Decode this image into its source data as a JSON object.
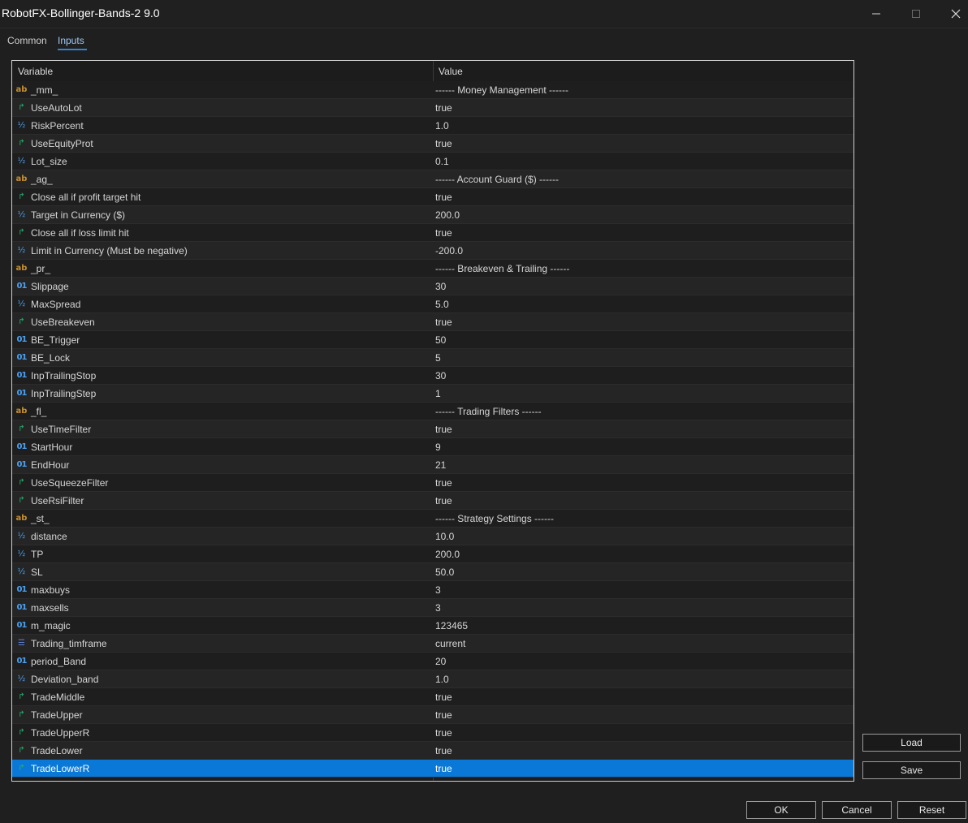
{
  "window": {
    "title": "RobotFX-Bollinger-Bands-2 9.0"
  },
  "tabs": [
    {
      "label": "Common"
    },
    {
      "label": "Inputs"
    }
  ],
  "table": {
    "headers": {
      "variable": "Variable",
      "value": "Value"
    },
    "rows": [
      {
        "type": "string",
        "variable": "_mm_",
        "value": "------ Money Management ------"
      },
      {
        "type": "bool",
        "variable": "UseAutoLot",
        "value": "true"
      },
      {
        "type": "double",
        "variable": "RiskPercent",
        "value": "1.0"
      },
      {
        "type": "bool",
        "variable": "UseEquityProt",
        "value": "true"
      },
      {
        "type": "double",
        "variable": "Lot_size",
        "value": "0.1"
      },
      {
        "type": "string",
        "variable": "_ag_",
        "value": "------ Account Guard ($) ------"
      },
      {
        "type": "bool",
        "variable": "Close all if profit target hit",
        "value": "true"
      },
      {
        "type": "double",
        "variable": "Target in Currency ($)",
        "value": "200.0"
      },
      {
        "type": "bool",
        "variable": "Close all if loss limit hit",
        "value": "true"
      },
      {
        "type": "double",
        "variable": "Limit in Currency (Must be negative)",
        "value": "-200.0"
      },
      {
        "type": "string",
        "variable": "_pr_",
        "value": "------ Breakeven & Trailing ------"
      },
      {
        "type": "int",
        "variable": "Slippage",
        "value": "30"
      },
      {
        "type": "double",
        "variable": "MaxSpread",
        "value": "5.0"
      },
      {
        "type": "bool",
        "variable": "UseBreakeven",
        "value": "true"
      },
      {
        "type": "int",
        "variable": "BE_Trigger",
        "value": "50"
      },
      {
        "type": "int",
        "variable": "BE_Lock",
        "value": "5"
      },
      {
        "type": "int",
        "variable": "InpTrailingStop",
        "value": "30"
      },
      {
        "type": "int",
        "variable": "InpTrailingStep",
        "value": "1"
      },
      {
        "type": "string",
        "variable": "_fl_",
        "value": "------ Trading Filters ------"
      },
      {
        "type": "bool",
        "variable": "UseTimeFilter",
        "value": "true"
      },
      {
        "type": "int",
        "variable": "StartHour",
        "value": "9"
      },
      {
        "type": "int",
        "variable": "EndHour",
        "value": "21"
      },
      {
        "type": "bool",
        "variable": "UseSqueezeFilter",
        "value": "true"
      },
      {
        "type": "bool",
        "variable": "UseRsiFilter",
        "value": "true"
      },
      {
        "type": "string",
        "variable": "_st_",
        "value": "------ Strategy Settings ------"
      },
      {
        "type": "double",
        "variable": "distance",
        "value": "10.0"
      },
      {
        "type": "double",
        "variable": "TP",
        "value": "200.0"
      },
      {
        "type": "double",
        "variable": "SL",
        "value": "50.0"
      },
      {
        "type": "int",
        "variable": "maxbuys",
        "value": "3"
      },
      {
        "type": "int",
        "variable": "maxsells",
        "value": "3"
      },
      {
        "type": "int",
        "variable": "m_magic",
        "value": "123465"
      },
      {
        "type": "enum",
        "variable": "Trading_timframe",
        "value": "current"
      },
      {
        "type": "int",
        "variable": "period_Band",
        "value": "20"
      },
      {
        "type": "double",
        "variable": "Deviation_band",
        "value": "1.0"
      },
      {
        "type": "bool",
        "variable": "TradeMiddle",
        "value": "true"
      },
      {
        "type": "bool",
        "variable": "TradeUpper",
        "value": "true"
      },
      {
        "type": "bool",
        "variable": "TradeUpperR",
        "value": "true"
      },
      {
        "type": "bool",
        "variable": "TradeLower",
        "value": "true"
      },
      {
        "type": "bool",
        "variable": "TradeLowerR",
        "value": "true",
        "selected": true
      }
    ]
  },
  "icons": {
    "string": {
      "glyph": "ab",
      "name": "string-type-icon"
    },
    "int": {
      "glyph": "01",
      "name": "integer-type-icon"
    },
    "double": {
      "glyph": "½",
      "name": "double-type-icon"
    },
    "bool": {
      "glyph": "↱",
      "name": "boolean-type-icon"
    },
    "enum": {
      "glyph": "☰",
      "name": "enum-type-icon"
    }
  },
  "side_buttons": {
    "load": "Load",
    "save": "Save"
  },
  "footer_buttons": {
    "ok": "OK",
    "cancel": "Cancel",
    "reset": "Reset"
  },
  "colors": {
    "selection": "#0a78d7",
    "accent_tab": "#2f86d8"
  }
}
